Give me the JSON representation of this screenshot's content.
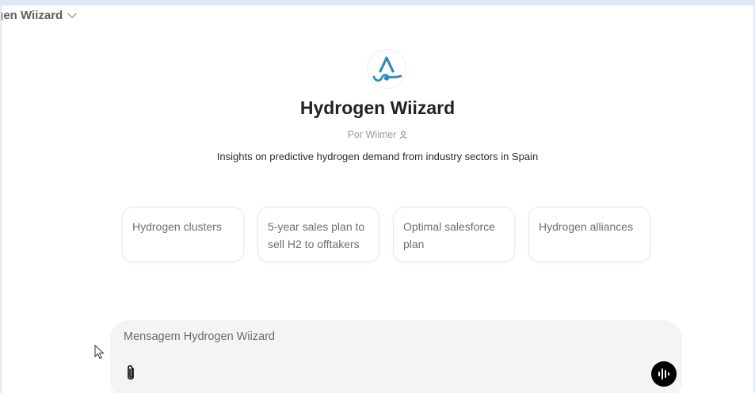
{
  "header": {
    "title": "ogen Wiizard",
    "dropdown_icon": "chevron-down-icon"
  },
  "gpt": {
    "logo_icon": "hydrogen-wiizard-logo",
    "name": "Hydrogen Wiizard",
    "author": "Por Wiimer",
    "author_icon": "person-icon",
    "description": "Insights on predictive hydrogen demand from industry sectors in Spain"
  },
  "starters": [
    {
      "label": "Hydrogen clusters"
    },
    {
      "label": "5-year sales plan to sell H2 to offtakers"
    },
    {
      "label": "Optimal salesforce plan"
    },
    {
      "label": "Hydrogen alliances"
    }
  ],
  "composer": {
    "placeholder": "Mensagem Hydrogen Wiizard",
    "attach_icon": "paperclip-icon",
    "voice_icon": "voice-mode-icon"
  },
  "colors": {
    "logo_blue": "#2a8fbd",
    "background": "#dbe9f6"
  }
}
